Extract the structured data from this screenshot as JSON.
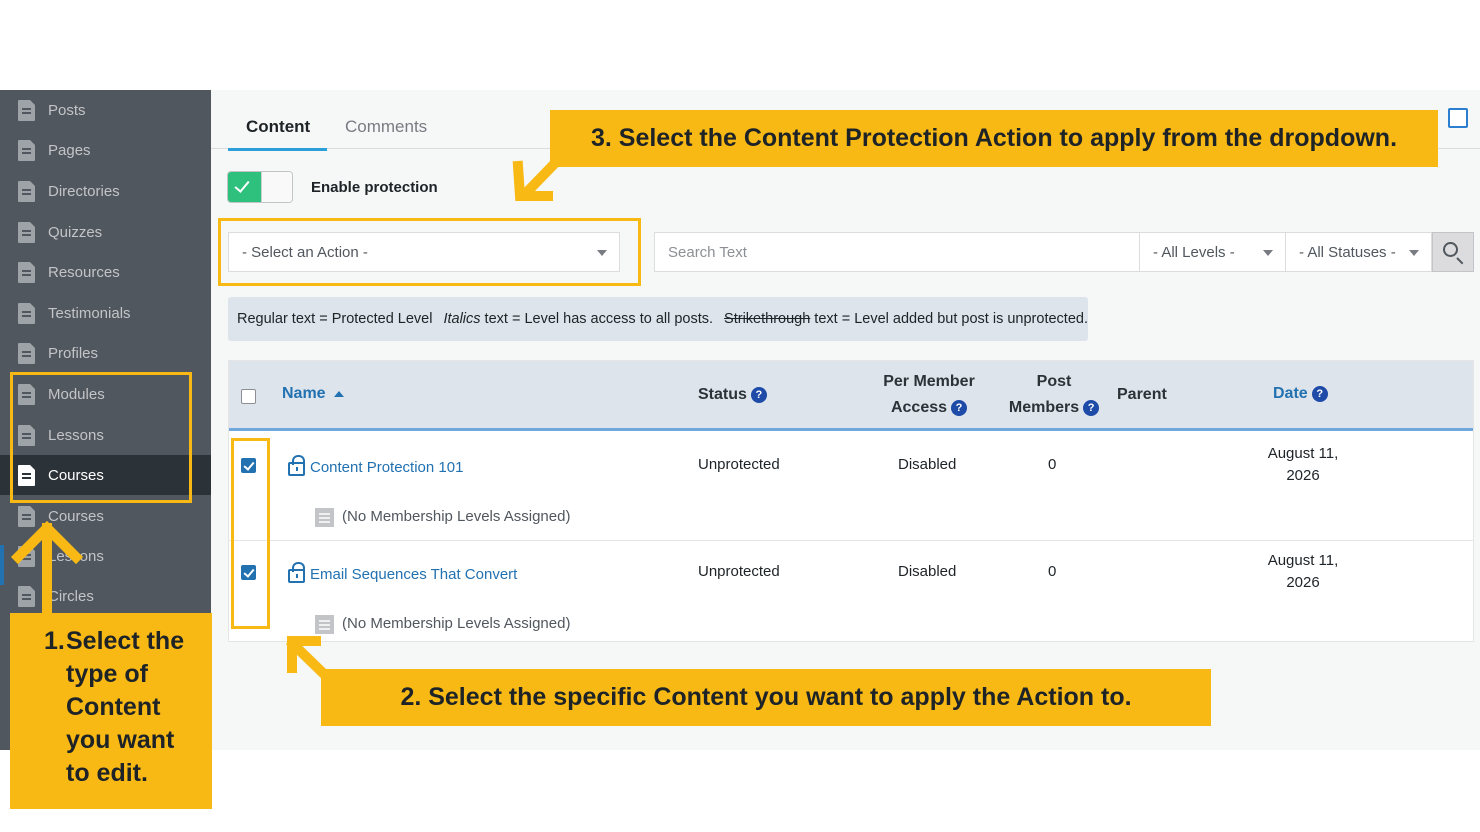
{
  "sidebar": {
    "items": [
      {
        "label": "Posts",
        "active": false
      },
      {
        "label": "Pages",
        "active": false
      },
      {
        "label": "Directories",
        "active": false
      },
      {
        "label": "Quizzes",
        "active": false
      },
      {
        "label": "Resources",
        "active": false
      },
      {
        "label": "Testimonials",
        "active": false
      },
      {
        "label": "Profiles",
        "active": false
      },
      {
        "label": "Modules",
        "active": false
      },
      {
        "label": "Lessons",
        "active": false
      },
      {
        "label": "Courses",
        "active": true
      },
      {
        "label": "Courses",
        "active": false
      },
      {
        "label": "Lessons",
        "active": false
      },
      {
        "label": "Circles",
        "active": false
      }
    ]
  },
  "tabs": [
    {
      "label": "Content",
      "active": true
    },
    {
      "label": "Comments",
      "active": false
    }
  ],
  "protection": {
    "enabled": true,
    "label": "Enable protection"
  },
  "filters": {
    "action_select": "- Select an Action -",
    "search_placeholder": "Search Text",
    "levels_select": "- All Levels -",
    "statuses_select": "- All Statuses -"
  },
  "legend": {
    "regular": "Regular text = Protected Level",
    "italics_word": "Italics",
    "italics_rest": "text = Level has access to all posts.",
    "strike_word": "Strikethrough",
    "strike_rest": "text = Level added but post is unprotected."
  },
  "table": {
    "headers": {
      "name": "Name",
      "status": "Status",
      "per_member_line1": "Per Member",
      "per_member_line2": "Access",
      "post_members_line1": "Post",
      "post_members_line2": "Members",
      "parent": "Parent",
      "date": "Date"
    },
    "rows": [
      {
        "checked": true,
        "title": "Content Protection 101",
        "status": "Unprotected",
        "per_member_access": "Disabled",
        "post_members": "0",
        "parent": "",
        "date_line1": "August 11,",
        "date_line2": "2026",
        "levels_note": "(No Membership Levels Assigned)"
      },
      {
        "checked": true,
        "title": "Email Sequences That Convert",
        "status": "Unprotected",
        "per_member_access": "Disabled",
        "post_members": "0",
        "parent": "",
        "date_line1": "August 11,",
        "date_line2": "2026",
        "levels_note": "(No Membership Levels Assigned)"
      }
    ]
  },
  "annotations": {
    "step1_num": "1.",
    "step1_text": "Select the type of Content you want to edit.",
    "step2": "2. Select the specific Content you want to apply the Action to.",
    "step3": "3. Select the Content Protection Action to apply from the dropdown."
  },
  "colors": {
    "sidebar_bg": "#50575e",
    "sidebar_active_bg": "#2c3338",
    "accent_blue": "#2271b1",
    "callout_yellow": "#f9b915",
    "toggle_green": "#2ec07d",
    "table_header_bg": "#dde4eb"
  },
  "icons": [
    "document-icon",
    "lock-icon",
    "help-icon",
    "search-icon",
    "sort-ascending-icon",
    "list-icon",
    "checkmark-icon",
    "arrow-icon"
  ]
}
